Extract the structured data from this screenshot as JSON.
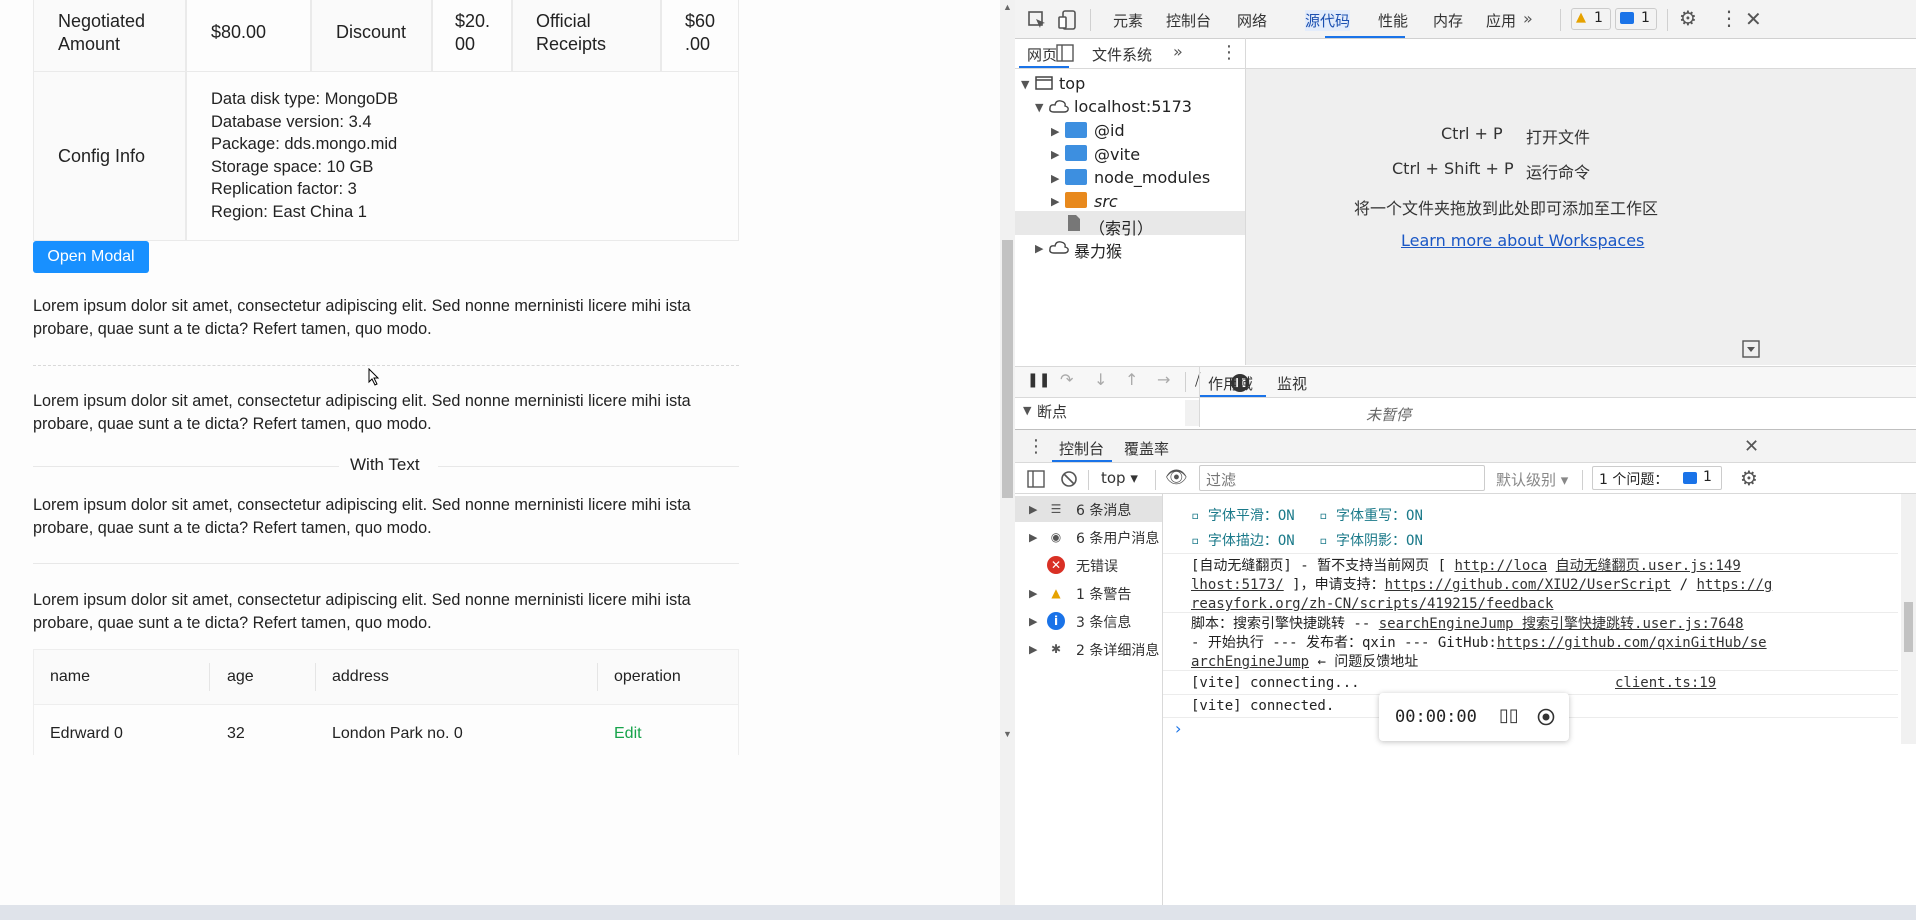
{
  "page": {
    "pricing_table": {
      "negotiated_label": "Negotiated\nAmount",
      "negotiated_value": "$80.00",
      "discount_label": "Discount",
      "discount_value_1": "$20.",
      "discount_value_2": "00",
      "official_label_1": "Official",
      "official_label_2": "Receipts",
      "official_value_1": "$60",
      "official_value_2": ".00",
      "config_label": "Config Info",
      "config_lines": [
        "Data disk type: MongoDB",
        "Database version: 3.4",
        "Package: dds.mongo.mid",
        "Storage space: 10 GB",
        "Replication factor: 3",
        "Region: East China 1"
      ]
    },
    "open_modal_label": "Open Modal",
    "paragraph": "Lorem ipsum dolor sit amet, consectetur adipiscing elit. Sed nonne merninisti licere mihi ista probare, quae sunt a te dicta? Refert tamen, quo modo.",
    "divider_text": "With Text",
    "data_table": {
      "headers": [
        "name",
        "age",
        "address",
        "operation"
      ],
      "rows": [
        {
          "name": "Edrward 0",
          "age": "32",
          "address": "London Park no. 0",
          "operation": "Edit"
        }
      ]
    }
  },
  "devtools": {
    "tabs": [
      "元素",
      "控制台",
      "网络",
      "源代码",
      "性能",
      "内存",
      "应用"
    ],
    "active_tab": "源代码",
    "warning_count": "1",
    "message_count": "1",
    "nav_tabs": [
      "网页",
      "文件系统"
    ],
    "tree": {
      "top": "top",
      "host": "localhost:5173",
      "folders": [
        "@id",
        "@vite",
        "node_modules",
        "src"
      ],
      "index": "（索引）",
      "other": "暴力猴"
    },
    "shortcuts": [
      {
        "keys": "Ctrl + P",
        "action": "打开文件"
      },
      {
        "keys": "Ctrl + Shift + P",
        "action": "运行命令"
      }
    ],
    "drop_hint": "将一个文件夹拖放到此处即可添加至工作区",
    "learn_more": "Learn more about Workspaces",
    "breakpoints_label": "断点",
    "scope_tabs": [
      "作用域",
      "监视"
    ],
    "not_paused": "未暂停",
    "drawer_tabs": [
      "控制台",
      "覆盖率"
    ],
    "console_toolbar": {
      "context": "top",
      "filter_placeholder": "过滤",
      "level": "默认级别",
      "issues_label": "1 个问题：",
      "issues_count": "1"
    },
    "sidebar": [
      {
        "label": "6 条消息",
        "icon": "list-icon"
      },
      {
        "label": "6 条用户消息",
        "icon": "user-icon"
      },
      {
        "label": "无错误",
        "icon": "error-icon"
      },
      {
        "label": "1 条警告",
        "icon": "warning-icon"
      },
      {
        "label": "3 条信息",
        "icon": "info-icon"
      },
      {
        "label": "2 条详细消息",
        "icon": "bug-icon"
      }
    ],
    "console": {
      "font_line_1a": "字体平滑：ON",
      "font_line_1b": "字体重写：ON",
      "font_line_2a": "字体描边：ON",
      "font_line_2b": "字体阴影：ON",
      "msg1_line1": "[自动无缝翻页] - 暂不支持当前网页 [",
      "msg1_url_a": "http://loca",
      "msg1_source": "自动无缝翻页.user.js:149",
      "msg1_url_b": "lhost:5173/",
      "msg1_line2_mid": "]，申请支持：",
      "msg1_link2": "https://github.com/XIU2/UserScript",
      "msg1_slash": "/",
      "msg1_link3a": "https://g",
      "msg1_link3b": "reasyfork.org/zh-CN/scripts/419215/feedback",
      "msg2_line1": "脚本：搜索引擎快捷跳转 --",
      "msg2_source": "searchEngineJump 搜索引擎快捷跳转.user.js:7648",
      "msg2_line2": "- 开始执行 --- 发布者：qxin --- GitHub:",
      "msg2_link_a": "https://github.com/qxinGitHub/se",
      "msg2_link_b": "archEngineJump",
      "msg2_tail": "← 问题反馈地址",
      "msg3": "[vite] connecting...",
      "msg3_source": "client.ts:19",
      "msg4": "[vite] connected."
    },
    "recorder_time": "00:00:00"
  },
  "colors": {
    "primary": "#1890ff",
    "devtools_accent": "#1a73e8",
    "edit_link": "#16a34a"
  }
}
